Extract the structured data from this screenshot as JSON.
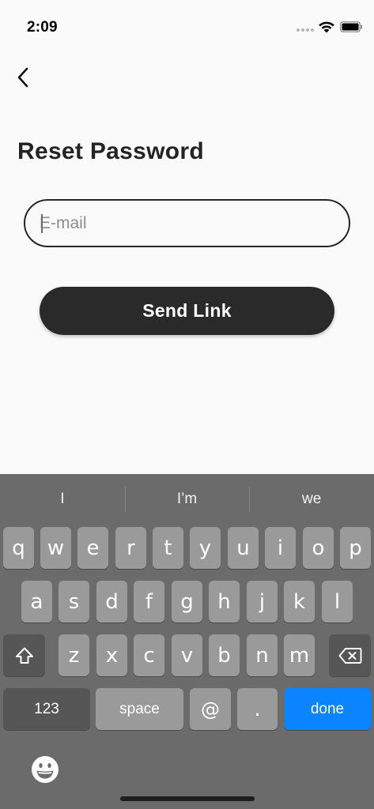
{
  "status_bar": {
    "time": "2:09"
  },
  "header": {
    "title": "Reset Password"
  },
  "form": {
    "email": {
      "value": "",
      "placeholder": "E-mail"
    },
    "send_label": "Send Link"
  },
  "keyboard": {
    "suggestions": [
      "I",
      "I’m",
      "we"
    ],
    "row1": [
      "q",
      "w",
      "e",
      "r",
      "t",
      "y",
      "u",
      "i",
      "o",
      "p"
    ],
    "row2": [
      "a",
      "s",
      "d",
      "f",
      "g",
      "h",
      "j",
      "k",
      "l"
    ],
    "row3": [
      "z",
      "x",
      "c",
      "v",
      "b",
      "n",
      "m"
    ],
    "bottom": {
      "numbers": "123",
      "space": "space",
      "at": "@",
      "dot": ".",
      "done": "done"
    },
    "colors": {
      "background": "#6b6b6b",
      "key": "#9a9a9a",
      "special_key": "#565656",
      "done": "#0a84ff"
    }
  },
  "icons": {
    "back": "chevron-left-icon",
    "shift": "shift-icon",
    "delete": "backspace-icon",
    "emoji": "emoji-icon",
    "wifi": "wifi-icon",
    "battery": "battery-icon"
  }
}
